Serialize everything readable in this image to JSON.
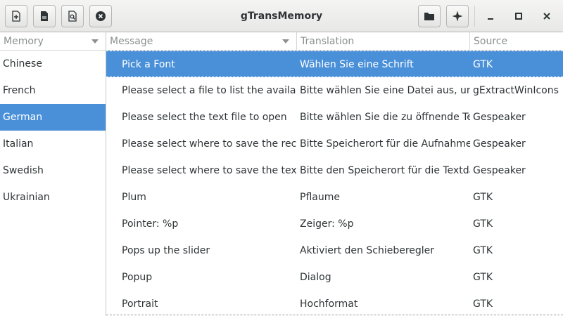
{
  "window": {
    "title": "gTransMemory"
  },
  "toolbar": {
    "new_icon": "new-file-icon",
    "open_icon": "open-file-icon",
    "preview_icon": "document-preview-icon",
    "remove_icon": "remove-circle-icon",
    "folder_icon": "folder-icon",
    "menu_icon": "star-menu-icon"
  },
  "window_controls": {
    "minimize": "minimize-icon",
    "maximize": "maximize-icon",
    "close": "close-icon"
  },
  "left_pane": {
    "header": "Memory",
    "items": [
      {
        "label": "Chinese",
        "selected": false
      },
      {
        "label": "French",
        "selected": false
      },
      {
        "label": "German",
        "selected": true
      },
      {
        "label": "Italian",
        "selected": false
      },
      {
        "label": "Swedish",
        "selected": false
      },
      {
        "label": "Ukrainian",
        "selected": false
      }
    ]
  },
  "table": {
    "headers": {
      "message": "Message",
      "translation": "Translation",
      "source": "Source"
    },
    "rows": [
      {
        "message": "Pick a Font",
        "translation": "Wählen Sie eine Schrift",
        "source": "GTK",
        "selected": true
      },
      {
        "message": "Please select a file to list the available",
        "translation": "Bitte wählen Sie eine Datei aus, um d",
        "source": "gExtractWinIcons"
      },
      {
        "message": "Please select the text file to open",
        "translation": "Bitte wählen Sie die zu öffnende Text",
        "source": "Gespeaker"
      },
      {
        "message": "Please select where to save the record",
        "translation": "Bitte Speicherort für die Aufnahme au",
        "source": "Gespeaker"
      },
      {
        "message": "Please select where to save the text fi",
        "translation": "Bitte den Speicherort für die Textdate",
        "source": "Gespeaker"
      },
      {
        "message": "Plum",
        "translation": "Pflaume",
        "source": "GTK"
      },
      {
        "message": "Pointer: %p",
        "translation": "Zeiger: %p",
        "source": "GTK"
      },
      {
        "message": "Pops up the slider",
        "translation": "Aktiviert den Schieberegler",
        "source": "GTK"
      },
      {
        "message": "Popup",
        "translation": "Dialog",
        "source": "GTK"
      },
      {
        "message": "Portrait",
        "translation": "Hochformat",
        "source": "GTK"
      }
    ]
  },
  "colors": {
    "selection": "#4a90d9",
    "text": "#2e3436",
    "header_text": "#8a8f8f"
  }
}
